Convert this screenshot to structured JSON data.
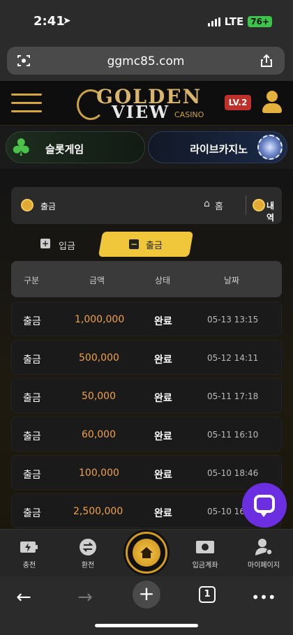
{
  "status_bar": {
    "time": "2:41",
    "network": "LTE",
    "battery": "76+"
  },
  "browser": {
    "url": "ggmc85.com",
    "tab_count": "1"
  },
  "header": {
    "logo_line1": "GOLDEN",
    "logo_line2": "VIEW",
    "logo_line3": "CASINO",
    "level_badge": "LV.2",
    "accent_color": "#d4a63b"
  },
  "banner": {
    "slot_label": "슬롯게임",
    "live_label": "라이브카지노"
  },
  "breadcrumb": {
    "title": "출금",
    "home_label": "홈",
    "history_label": "내역"
  },
  "tabs": {
    "deposit_label": "입금",
    "withdraw_label": "출금"
  },
  "table": {
    "headers": [
      "구분",
      "금액",
      "상태",
      "날짜"
    ],
    "rows": [
      {
        "type": "출금",
        "amount": "1,000,000",
        "status": "완료",
        "date": "05-13 13:15"
      },
      {
        "type": "출금",
        "amount": "500,000",
        "status": "완료",
        "date": "05-12 14:11"
      },
      {
        "type": "출금",
        "amount": "50,000",
        "status": "완료",
        "date": "05-11 17:18"
      },
      {
        "type": "출금",
        "amount": "60,000",
        "status": "완료",
        "date": "05-11 16:10"
      },
      {
        "type": "출금",
        "amount": "100,000",
        "status": "완료",
        "date": "05-10 18:46"
      },
      {
        "type": "출금",
        "amount": "2,500,000",
        "status": "완료",
        "date": "05-10 16:"
      }
    ]
  },
  "bottom_nav": {
    "charge": "충전",
    "exchange": "환전",
    "account": "입금계좌",
    "mypage": "마이페이지"
  }
}
